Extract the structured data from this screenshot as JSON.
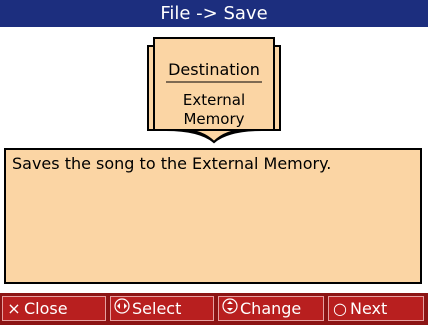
{
  "title": "File -> Save",
  "book": {
    "heading": "Destination",
    "value_line1": "External",
    "value_line2": "Memory"
  },
  "message": "Saves the song to the External Memory.",
  "footer": {
    "close": "Close",
    "select": "Select",
    "change": "Change",
    "next": "Next"
  },
  "colors": {
    "title_bg": "#1c2e7e",
    "panel_bg": "#fbd5a4",
    "footer_bg": "#8c1414"
  },
  "icons": [
    "close-x-icon",
    "left-right-arrows-icon",
    "up-down-arrows-icon",
    "circle-icon"
  ]
}
